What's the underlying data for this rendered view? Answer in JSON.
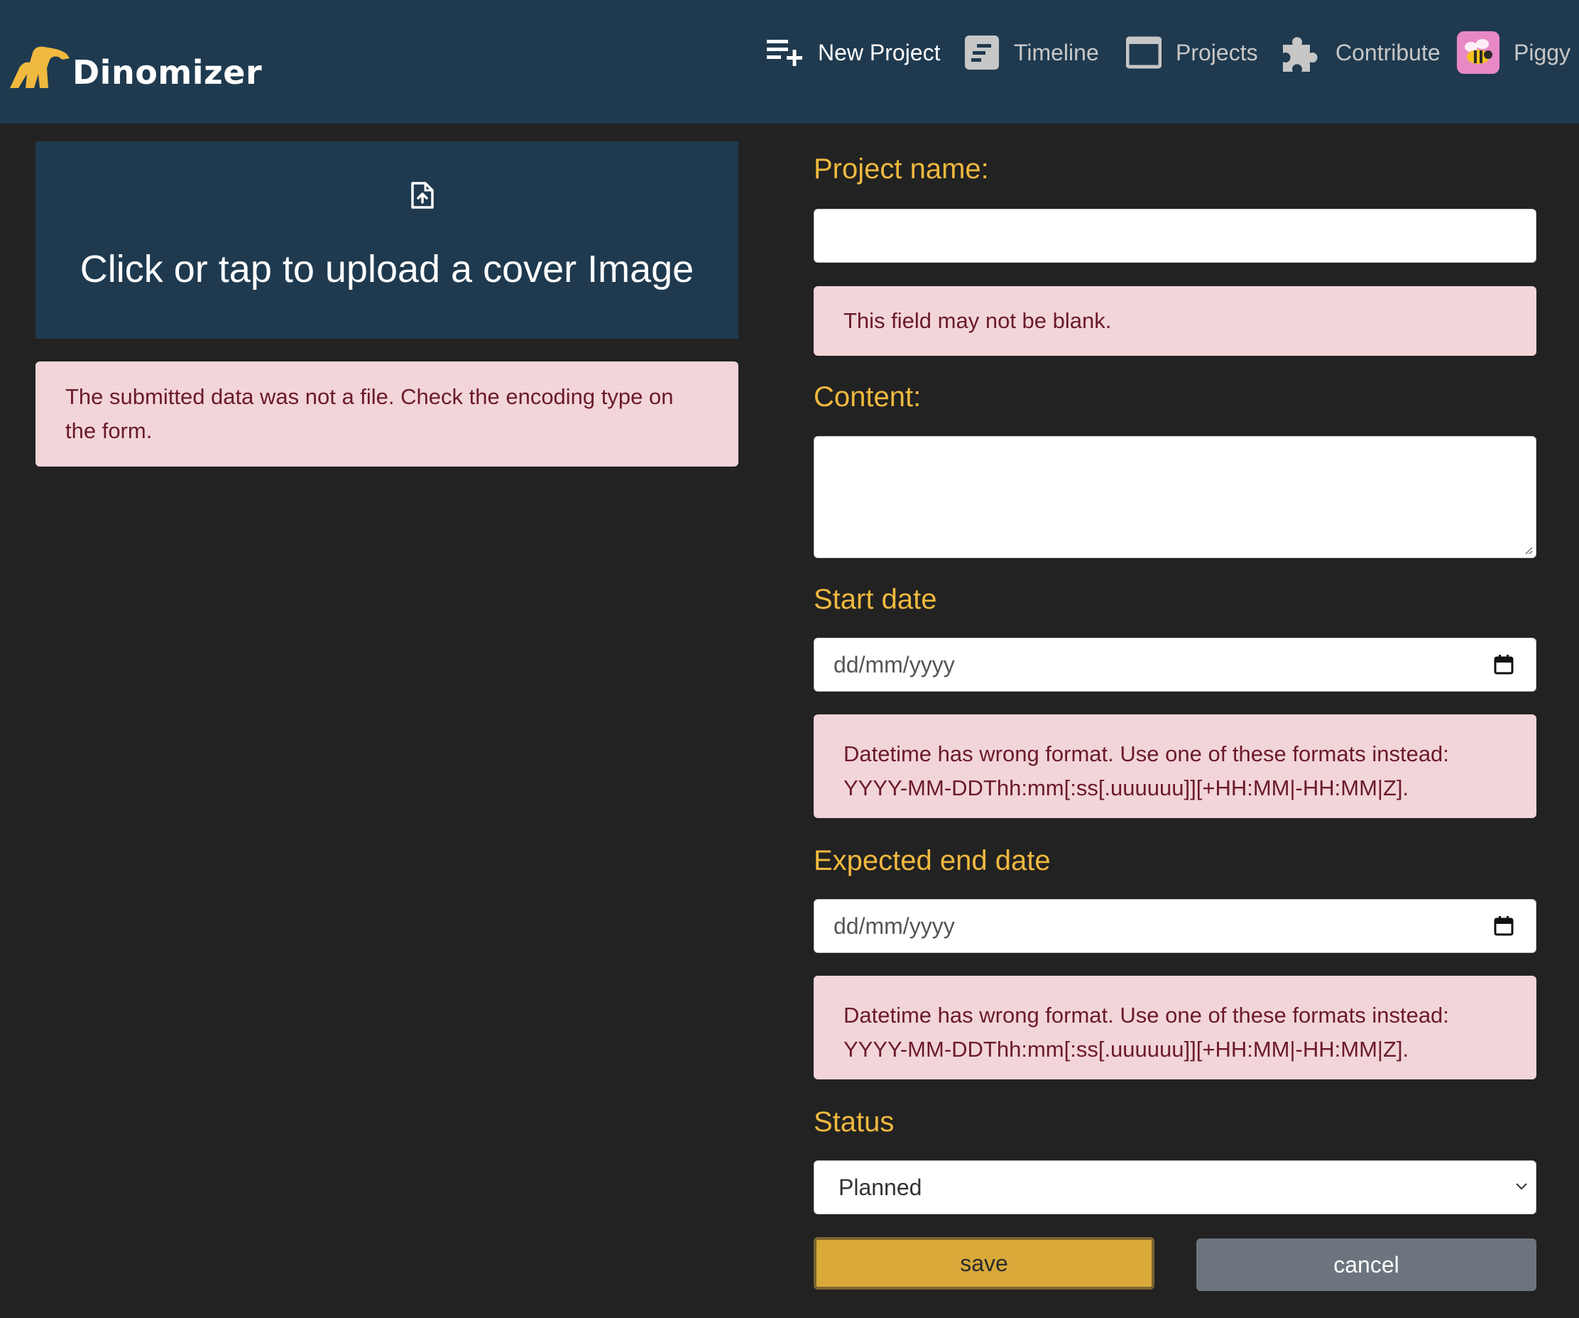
{
  "header": {
    "brand": "Dinomizer",
    "nav": [
      {
        "label": "New Project",
        "icon": "playlist-add-icon",
        "active": true
      },
      {
        "label": "Timeline",
        "icon": "timeline-icon",
        "active": false
      },
      {
        "label": "Projects",
        "icon": "window-icon",
        "active": false
      },
      {
        "label": "Contribute",
        "icon": "puzzle-icon",
        "active": false
      }
    ],
    "user": {
      "name": "Piggy",
      "avatar_icon": "bee-avatar-icon"
    }
  },
  "upload": {
    "label": "Click or tap to upload a cover Image",
    "icon": "file-upload-icon",
    "error": "The submitted data was not a file. Check the encoding type on the form."
  },
  "form": {
    "project_name": {
      "label": "Project name:",
      "value": "",
      "error": "This field may not be blank."
    },
    "content": {
      "label": "Content:",
      "value": ""
    },
    "start_date": {
      "label": "Start date",
      "placeholder": "dd/mm/yyyy",
      "error_line1": "Datetime has wrong format. Use one of these formats instead:",
      "error_line2": "YYYY-MM-DDThh:mm[:ss[.uuuuuu]][+HH:MM|-HH:MM|Z]."
    },
    "end_date": {
      "label": "Expected end date",
      "placeholder": "dd/mm/yyyy",
      "error_line1": "Datetime has wrong format. Use one of these formats instead:",
      "error_line2": "YYYY-MM-DDThh:mm[:ss[.uuuuuu]][+HH:MM|-HH:MM|Z]."
    },
    "status": {
      "label": "Status",
      "selected": "Planned"
    },
    "save_label": "save",
    "cancel_label": "cancel"
  },
  "colors": {
    "header_bg": "#1f3a4f",
    "page_bg": "#222222",
    "label_accent": "#f0b93f",
    "error_bg": "#f2d5d9",
    "error_text": "#6b1a2a",
    "save_bg": "#d9a93a",
    "cancel_bg": "#6c757d"
  }
}
